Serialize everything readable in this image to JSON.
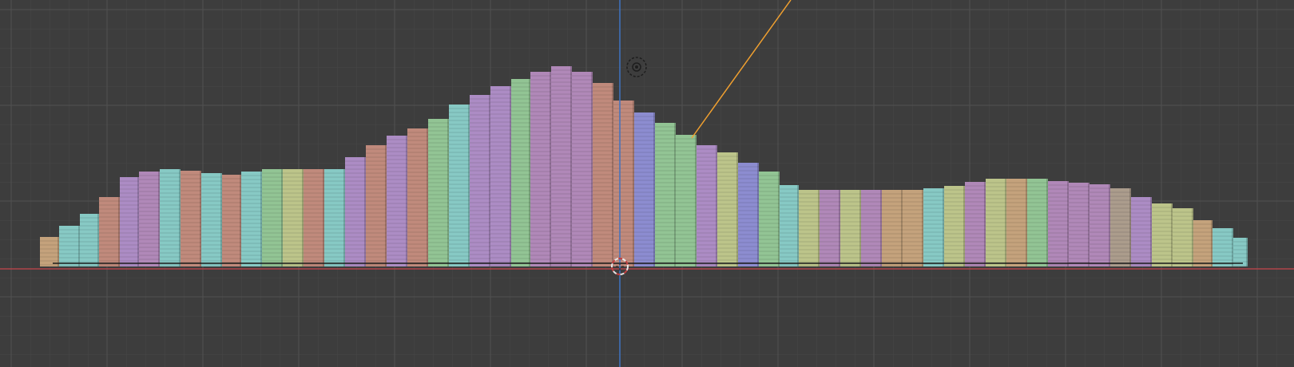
{
  "viewport": {
    "view": "front-orthographic",
    "background_color": "#3d3d3d",
    "grid": true,
    "grid_minor_color": "#474747",
    "grid_major_color": "#515151",
    "x_axis_color": "#b0454a",
    "z_axis_color": "#3f73c2",
    "camera_line_color": "#f0a030",
    "cursor_ring_colors": [
      "#e8e8e8",
      "#c04040"
    ]
  },
  "mesh": {
    "object_palette": [
      "#c4a27c",
      "#87c9c4",
      "#c08a7c",
      "#ac8cc4",
      "#b088b8",
      "#92c494",
      "#bcc48a",
      "#8c8cd0",
      "#ab9c8c"
    ],
    "edge_shade_color": "#000000"
  },
  "icons": {
    "light": "light-icon",
    "cursor": "3d-cursor-icon",
    "camera": "camera-icon"
  }
}
